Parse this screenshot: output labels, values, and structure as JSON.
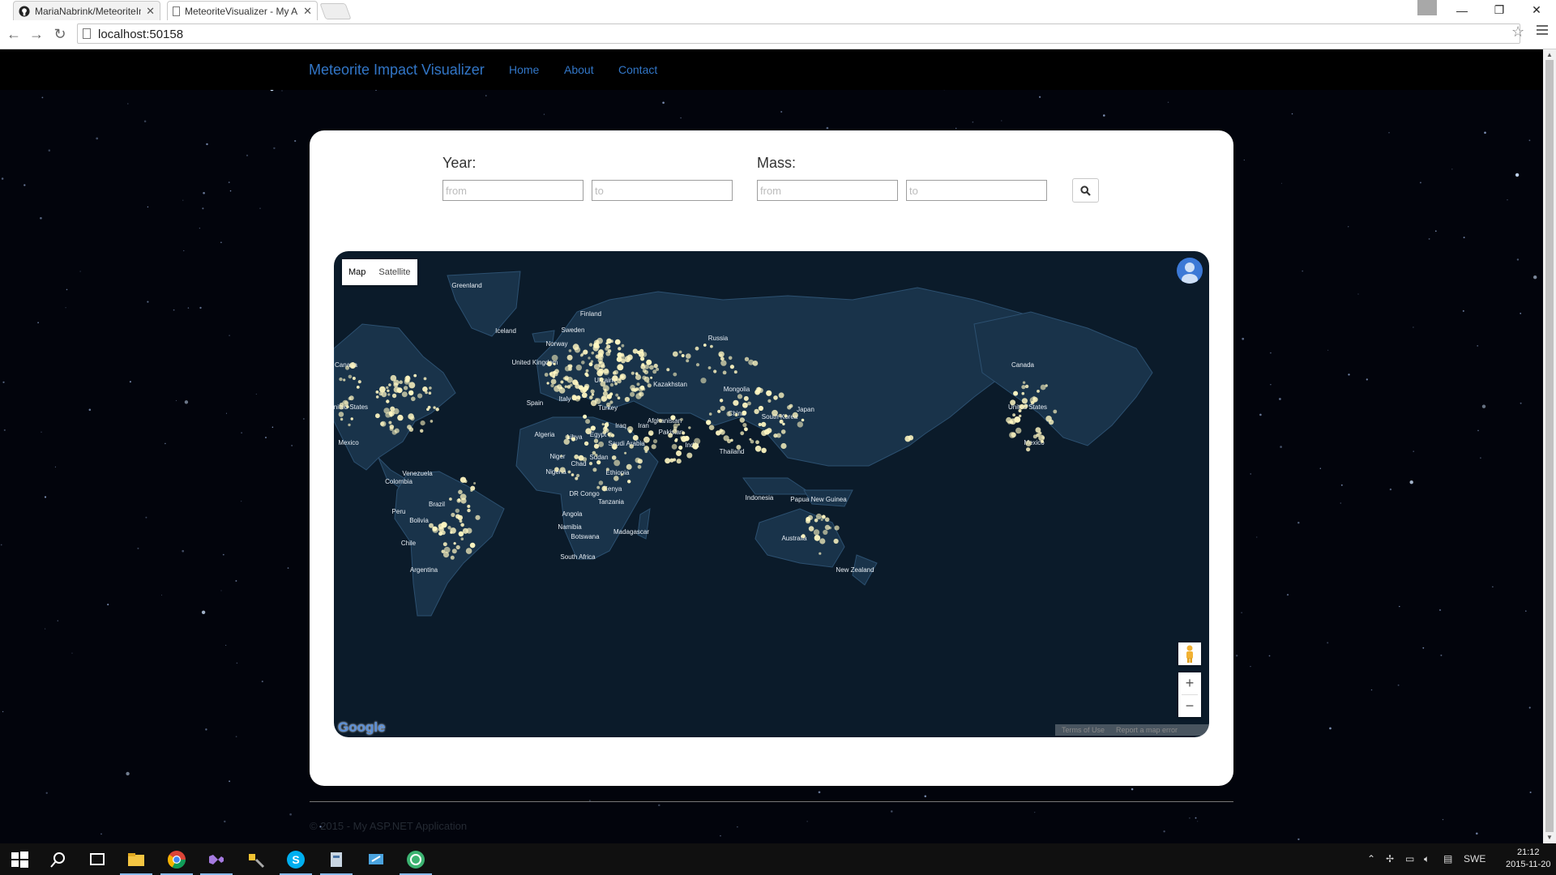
{
  "browser": {
    "tabs": [
      {
        "title": "MariaNabrink/MeteoriteIm",
        "active": false,
        "icon": "github-icon"
      },
      {
        "title": "MeteoriteVisualizer - My A",
        "active": true,
        "icon": "page-icon"
      }
    ],
    "url": "localhost:50158"
  },
  "site": {
    "brand": "Meteorite Impact Visualizer",
    "nav": [
      "Home",
      "About",
      "Contact"
    ]
  },
  "filters": {
    "year": {
      "label": "Year:",
      "from_placeholder": "from",
      "to_placeholder": "to"
    },
    "mass": {
      "label": "Mass:",
      "from_placeholder": "from",
      "to_placeholder": "to"
    },
    "search_icon": "search-icon"
  },
  "map": {
    "type_controls": [
      "Map",
      "Satellite"
    ],
    "selected_type": "Map",
    "labels": [
      "Greenland",
      "Iceland",
      "Finland",
      "Sweden",
      "Norway",
      "United Kingdom",
      "Ukraine",
      "Spain",
      "Italy",
      "Turkey",
      "Kazakhstan",
      "Russia",
      "Mongolia",
      "China",
      "South Korea",
      "Japan",
      "Afghanistan",
      "Iran",
      "Iraq",
      "Pakistan",
      "India",
      "Thailand",
      "Algeria",
      "Libya",
      "Egypt",
      "Saudi Arabia",
      "Niger",
      "Chad",
      "Sudan",
      "Nigeria",
      "Ethiopia",
      "Kenya",
      "DR Congo",
      "Tanzania",
      "Angola",
      "Namibia",
      "Botswana",
      "Madagascar",
      "South Africa",
      "Indonesia",
      "Papua New Guinea",
      "Australia",
      "New Zealand",
      "Canada",
      "United States",
      "Mexico",
      "Venezuela",
      "Colombia",
      "Peru",
      "Brazil",
      "Bolivia",
      "Chile",
      "Argentina"
    ],
    "zoom_in": "+",
    "zoom_out": "−",
    "logo": "Google",
    "footer_links": [
      "Terms of Use",
      "Report a map error"
    ],
    "colors": {
      "ocean": "#0b1b2a",
      "land": "#19334a",
      "glow": "#fff7c2"
    }
  },
  "footer": {
    "text": "© 2015 - My ASP.NET Application"
  },
  "taskbar": {
    "language": "SWE",
    "time": "21:12",
    "date": "2015-11-20"
  }
}
